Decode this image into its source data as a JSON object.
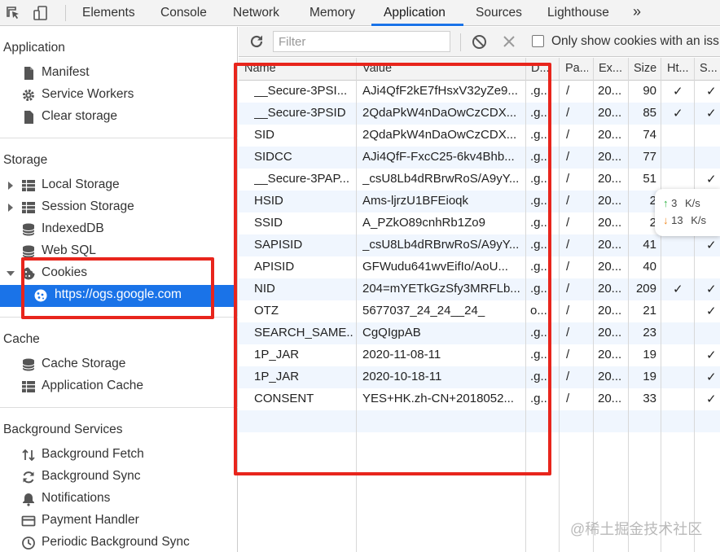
{
  "tabs": [
    {
      "label": "Elements"
    },
    {
      "label": "Console"
    },
    {
      "label": "Network"
    },
    {
      "label": "Memory"
    },
    {
      "label": "Application"
    },
    {
      "label": "Sources"
    },
    {
      "label": "Lighthouse"
    }
  ],
  "active_tab": "Application",
  "more_tabs_glyph": "»",
  "sidebar": {
    "application_header": "Application",
    "application_items": [
      {
        "label": "Manifest",
        "icon": "document-icon"
      },
      {
        "label": "Service Workers",
        "icon": "gear-icon"
      },
      {
        "label": "Clear storage",
        "icon": "trash-icon"
      }
    ],
    "storage_header": "Storage",
    "storage_items": [
      {
        "label": "Local Storage",
        "icon": "grid-icon"
      },
      {
        "label": "Session Storage",
        "icon": "grid-icon"
      },
      {
        "label": "IndexedDB",
        "icon": "database-icon"
      },
      {
        "label": "Web SQL",
        "icon": "database-icon"
      },
      {
        "label": "Cookies",
        "icon": "cookie-icon"
      },
      {
        "label": "https://ogs.google.com",
        "icon": "cookie-icon"
      }
    ],
    "cache_header": "Cache",
    "cache_items": [
      {
        "label": "Cache Storage",
        "icon": "database-icon"
      },
      {
        "label": "Application Cache",
        "icon": "grid-icon"
      }
    ],
    "bg_header": "Background Services",
    "bg_items": [
      {
        "label": "Background Fetch",
        "icon": "arrows-updown-icon"
      },
      {
        "label": "Background Sync",
        "icon": "sync-icon"
      },
      {
        "label": "Notifications",
        "icon": "bell-icon"
      },
      {
        "label": "Payment Handler",
        "icon": "card-icon"
      },
      {
        "label": "Periodic Background Sync",
        "icon": "clock-icon"
      }
    ]
  },
  "cookie_toolbar": {
    "filter_placeholder": "Filter",
    "only_show_label": "Only show cookies with an iss"
  },
  "table": {
    "headers": [
      "Name",
      "Value",
      "D...",
      "Pa...",
      "Ex...",
      "Size",
      "Ht...",
      "S..."
    ],
    "rows": [
      {
        "name": "__Secure-3PSI...",
        "value": "AJi4QfF2kE7fHsxV32yZe9...",
        "domain": ".g...",
        "path": "/",
        "expires": "20...",
        "size": "90",
        "http": "✓",
        "secure": "✓"
      },
      {
        "name": "__Secure-3PSID",
        "value": "2QdaPkW4nDaOwCzCDX...",
        "domain": ".g...",
        "path": "/",
        "expires": "20...",
        "size": "85",
        "http": "✓",
        "secure": "✓"
      },
      {
        "name": "SID",
        "value": "2QdaPkW4nDaOwCzCDX...",
        "domain": ".g...",
        "path": "/",
        "expires": "20...",
        "size": "74",
        "http": "",
        "secure": ""
      },
      {
        "name": "SIDCC",
        "value": "AJi4QfF-FxcC25-6kv4Bhb...",
        "domain": ".g...",
        "path": "/",
        "expires": "20...",
        "size": "77",
        "http": "",
        "secure": ""
      },
      {
        "name": "__Secure-3PAP...",
        "value": "_csU8Lb4dRBrwRoS/A9yY...",
        "domain": ".g...",
        "path": "/",
        "expires": "20...",
        "size": "51",
        "http": "",
        "secure": "✓"
      },
      {
        "name": "HSID",
        "value": "Ams-ljrzU1BFEioqk",
        "domain": ".g...",
        "path": "/",
        "expires": "20...",
        "size": "2",
        "http": "",
        "secure": ""
      },
      {
        "name": "SSID",
        "value": "A_PZkO89cnhRb1Zo9",
        "domain": ".g...",
        "path": "/",
        "expires": "20...",
        "size": "2",
        "http": "",
        "secure": ""
      },
      {
        "name": "SAPISID",
        "value": "_csU8Lb4dRBrwRoS/A9yY...",
        "domain": ".g...",
        "path": "/",
        "expires": "20...",
        "size": "41",
        "http": "",
        "secure": "✓"
      },
      {
        "name": "APISID",
        "value": "GFWudu641wvEifIo/AoU...",
        "domain": ".g...",
        "path": "/",
        "expires": "20...",
        "size": "40",
        "http": "",
        "secure": ""
      },
      {
        "name": "NID",
        "value": "204=mYETkGzSfy3MRFLb...",
        "domain": ".g...",
        "path": "/",
        "expires": "20...",
        "size": "209",
        "http": "✓",
        "secure": "✓"
      },
      {
        "name": "OTZ",
        "value": "5677037_24_24__24_",
        "domain": "o...",
        "path": "/",
        "expires": "20...",
        "size": "21",
        "http": "",
        "secure": "✓"
      },
      {
        "name": "SEARCH_SAME...",
        "value": "CgQIgpAB",
        "domain": ".g...",
        "path": "/",
        "expires": "20...",
        "size": "23",
        "http": "",
        "secure": ""
      },
      {
        "name": "1P_JAR",
        "value": "2020-11-08-11",
        "domain": ".g...",
        "path": "/",
        "expires": "20...",
        "size": "19",
        "http": "",
        "secure": "✓"
      },
      {
        "name": "1P_JAR",
        "value": "2020-10-18-11",
        "domain": ".g...",
        "path": "/",
        "expires": "20...",
        "size": "19",
        "http": "",
        "secure": "✓"
      },
      {
        "name": "CONSENT",
        "value": "YES+HK.zh-CN+2018052...",
        "domain": ".g...",
        "path": "/",
        "expires": "20...",
        "size": "33",
        "http": "",
        "secure": "✓"
      }
    ]
  },
  "net_widget": {
    "up_value": "3",
    "up_unit": "K/s",
    "down_value": "13",
    "down_unit": "K/s"
  },
  "watermark": "@稀土掘金技术社区",
  "colors": {
    "accent": "#1a73e8",
    "annotation_red": "#e8251c"
  }
}
